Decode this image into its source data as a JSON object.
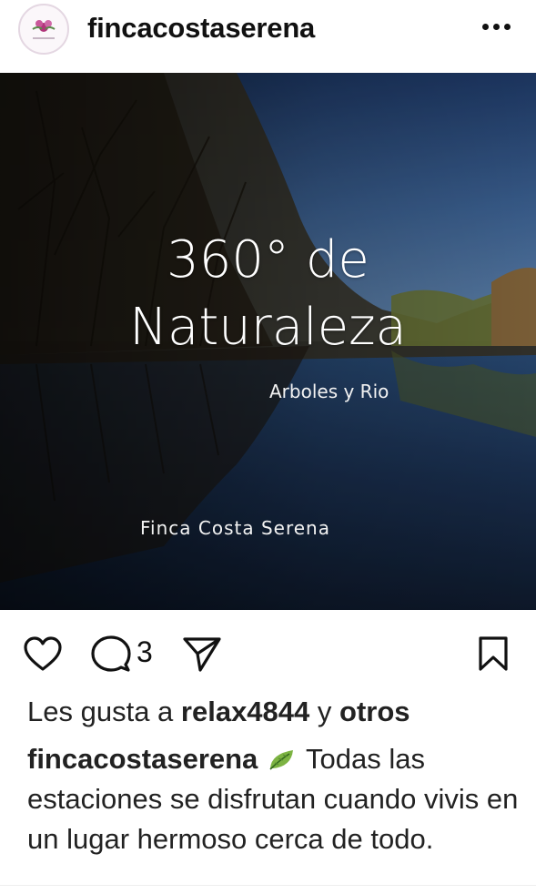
{
  "header": {
    "username": "fincacostaserena",
    "more_icon": "more-horizontal-icon"
  },
  "post": {
    "title_line1": "360° de",
    "title_line2": "Naturaleza",
    "subtitle": "Arboles y Rio",
    "brand": "Finca Costa  Serena"
  },
  "actions": {
    "like_icon": "heart-icon",
    "comment_icon": "comment-icon",
    "comment_count": "3",
    "share_icon": "send-icon",
    "save_icon": "bookmark-icon"
  },
  "likes": {
    "prefix": "Les gusta a ",
    "user": "relax4844",
    "middle": " y ",
    "others": "otros"
  },
  "caption": {
    "username": "fincacostaserena",
    "emoji": "leaf-emoji",
    "text": " Todas las estaciones se disfrutan cuando vivis en un lugar hermoso cerca de todo."
  }
}
